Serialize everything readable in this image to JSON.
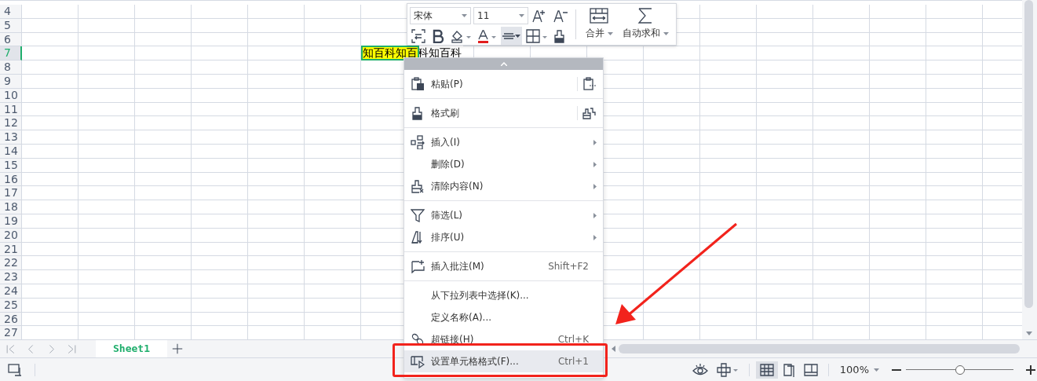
{
  "row_headers": [
    {
      "label": "4",
      "selected": false
    },
    {
      "label": "5",
      "selected": false
    },
    {
      "label": "6",
      "selected": false
    },
    {
      "label": "7",
      "selected": true
    },
    {
      "label": "8",
      "selected": false
    },
    {
      "label": "9",
      "selected": false
    },
    {
      "label": "10",
      "selected": false
    },
    {
      "label": "11",
      "selected": false
    },
    {
      "label": "12",
      "selected": false
    },
    {
      "label": "13",
      "selected": false
    },
    {
      "label": "14",
      "selected": false
    },
    {
      "label": "15",
      "selected": false
    },
    {
      "label": "16",
      "selected": false
    },
    {
      "label": "17",
      "selected": false
    },
    {
      "label": "18",
      "selected": false
    },
    {
      "label": "19",
      "selected": false
    },
    {
      "label": "20",
      "selected": false
    },
    {
      "label": "21",
      "selected": false
    },
    {
      "label": "22",
      "selected": false
    },
    {
      "label": "23",
      "selected": false
    },
    {
      "label": "24",
      "selected": false
    },
    {
      "label": "25",
      "selected": false
    },
    {
      "label": "26",
      "selected": false
    },
    {
      "label": "27",
      "selected": false
    }
  ],
  "active_cell": {
    "text": "知百科知百科知百科"
  },
  "mini_toolbar": {
    "font_name": "宋体",
    "font_size": "11",
    "buttons": [
      {
        "label": "合并"
      },
      {
        "label": "自动求和"
      }
    ]
  },
  "context_menu": {
    "groups": [
      [
        {
          "label": "粘贴(P)",
          "submenu": false,
          "selected": false
        }
      ],
      [
        {
          "label": "格式刷",
          "submenu": false,
          "selected": false
        }
      ],
      [
        {
          "label": "插入(I)",
          "submenu": true,
          "selected": false
        },
        {
          "label": "删除(D)",
          "submenu": true,
          "selected": false
        },
        {
          "label": "清除内容(N)",
          "submenu": true,
          "selected": false
        }
      ],
      [
        {
          "label": "筛选(L)",
          "submenu": true,
          "selected": false
        },
        {
          "label": "排序(U)",
          "submenu": true,
          "selected": false
        }
      ],
      [
        {
          "label": "插入批注(M)",
          "shortcut": "Shift+F2",
          "submenu": false,
          "selected": false
        }
      ],
      [
        {
          "label": "从下拉列表中选择(K)...",
          "submenu": false,
          "selected": false
        },
        {
          "label": "定义名称(A)...",
          "submenu": false,
          "selected": false
        },
        {
          "label": "超链接(H)",
          "shortcut": "Ctrl+K",
          "submenu": false,
          "selected": false
        },
        {
          "label": "设置单元格格式(F)...",
          "shortcut": "Ctrl+1",
          "submenu": false,
          "selected": true
        }
      ]
    ]
  },
  "sheet_tabs": [
    {
      "label": "Sheet1",
      "selected": true
    }
  ],
  "status_bar": {
    "zoom": "100%",
    "zoom_slider": {
      "level": 0.5
    }
  }
}
